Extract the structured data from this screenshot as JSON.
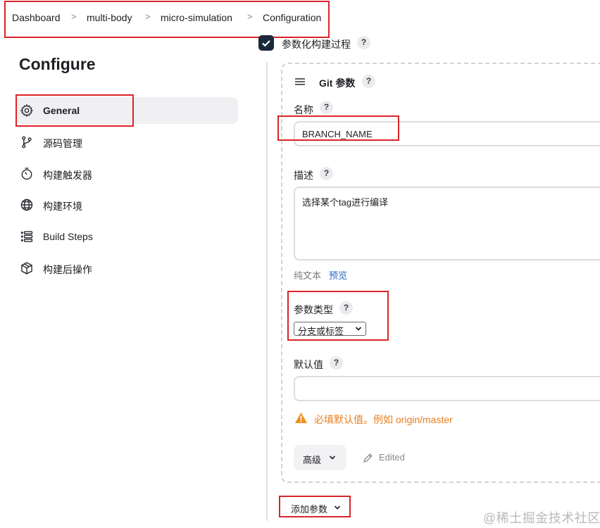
{
  "breadcrumb": {
    "items": [
      "Dashboard",
      "multi-body",
      "micro-simulation",
      "Configuration"
    ],
    "separator": ">"
  },
  "sidebar": {
    "title": "Configure",
    "items": [
      {
        "label": "General",
        "icon": "gear-icon",
        "active": true
      },
      {
        "label": "源码管理",
        "icon": "branch-icon",
        "active": false
      },
      {
        "label": "构建触发器",
        "icon": "timer-icon",
        "active": false
      },
      {
        "label": "构建环境",
        "icon": "globe-icon",
        "active": false
      },
      {
        "label": "Build Steps",
        "icon": "list-icon",
        "active": false
      },
      {
        "label": "构建后操作",
        "icon": "package-icon",
        "active": false
      }
    ]
  },
  "parameterized": {
    "label": "参数化构建过程",
    "checked": true,
    "help": "?"
  },
  "git_param": {
    "header": "Git 参数",
    "help": "?",
    "name": {
      "label": "名称",
      "help": "?",
      "value": "BRANCH_NAME"
    },
    "description": {
      "label": "描述",
      "help": "?",
      "value": "选择某个tag进行编译"
    },
    "format": {
      "plain_text": "纯文本",
      "preview": "预览"
    },
    "param_type": {
      "label": "参数类型",
      "help": "?",
      "selected": "分支或标签"
    },
    "default_value": {
      "label": "默认值",
      "help": "?",
      "value": ""
    },
    "warning": "必填默认值。例如 origin/master",
    "advanced_button": "高级",
    "edited_label": "Edited"
  },
  "add_param_button": "添加参数",
  "watermark": "@稀土掘金技术社区",
  "colors": {
    "accent_link": "#1f68c9",
    "warning": "#e67e1f",
    "annotation_red": "#d9252b",
    "checkbox": "#1b2a3a"
  }
}
